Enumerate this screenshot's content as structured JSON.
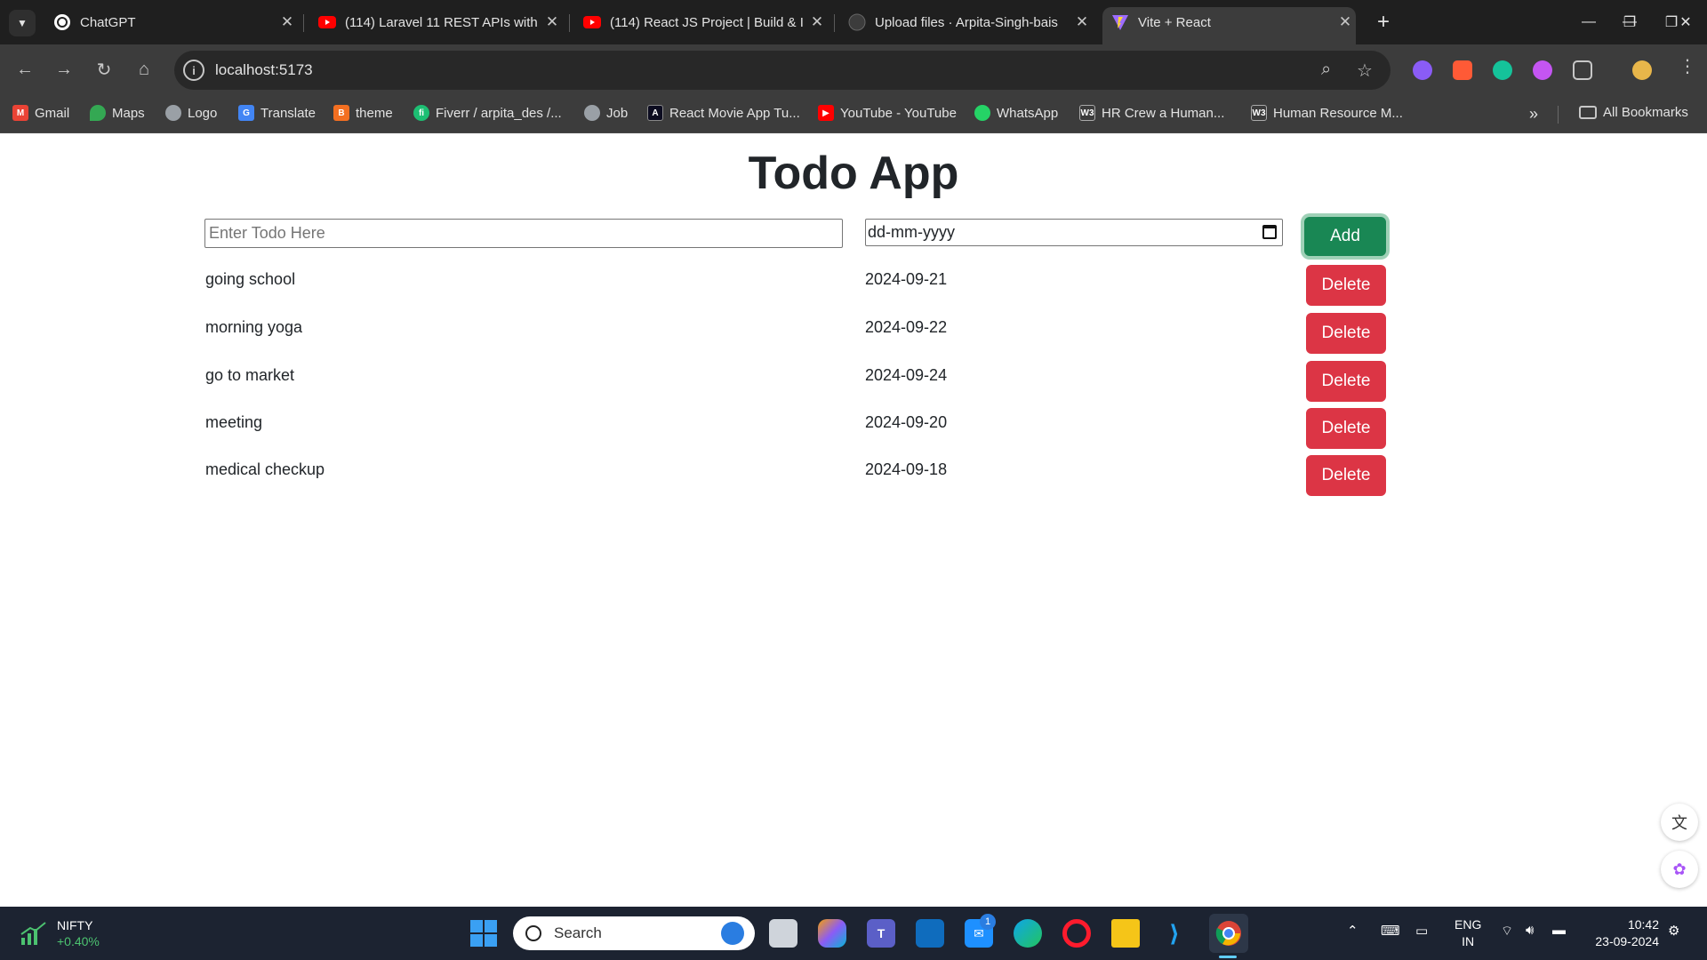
{
  "browser": {
    "tabs": [
      {
        "title": "ChatGPT",
        "active": false
      },
      {
        "title": "(114) Laravel 11 REST APIs with",
        "active": false
      },
      {
        "title": "(114) React JS Project | Build & I",
        "active": false
      },
      {
        "title": "Upload files · Arpita-Singh-bais",
        "active": false
      },
      {
        "title": "Vite + React",
        "active": true
      }
    ],
    "url": "localhost:5173",
    "bookmarks": [
      "Gmail",
      "Maps",
      "Logo",
      "Translate",
      "theme",
      "Fiverr / arpita_des /...",
      "Job",
      "React Movie App Tu...",
      "YouTube - YouTube",
      "WhatsApp",
      "HR Crew a Human...",
      "Human Resource M..."
    ],
    "all_bookmarks": "All Bookmarks"
  },
  "app": {
    "title": "Todo App",
    "todo_placeholder": "Enter Todo Here",
    "date_placeholder": "dd-mm-yyyy",
    "add_label": "Add",
    "delete_label": "Delete",
    "todos": [
      {
        "name": "going school",
        "date": "2024-09-21"
      },
      {
        "name": "morning yoga",
        "date": "2024-09-22"
      },
      {
        "name": "go to market",
        "date": "2024-09-24"
      },
      {
        "name": "meeting",
        "date": "2024-09-20"
      },
      {
        "name": "medical checkup",
        "date": "2024-09-18"
      }
    ]
  },
  "taskbar": {
    "nifty_label": "NIFTY",
    "nifty_change": "+0.40%",
    "search_label": "Search",
    "lang_top": "ENG",
    "lang_bottom": "IN",
    "time": "10:42",
    "date": "23-09-2024",
    "teams_badge": "1"
  },
  "colors": {
    "add_button": "#198754",
    "delete_button": "#dc3545",
    "browser_chrome": "#3c3c3c",
    "taskbar": "#1c2331"
  }
}
